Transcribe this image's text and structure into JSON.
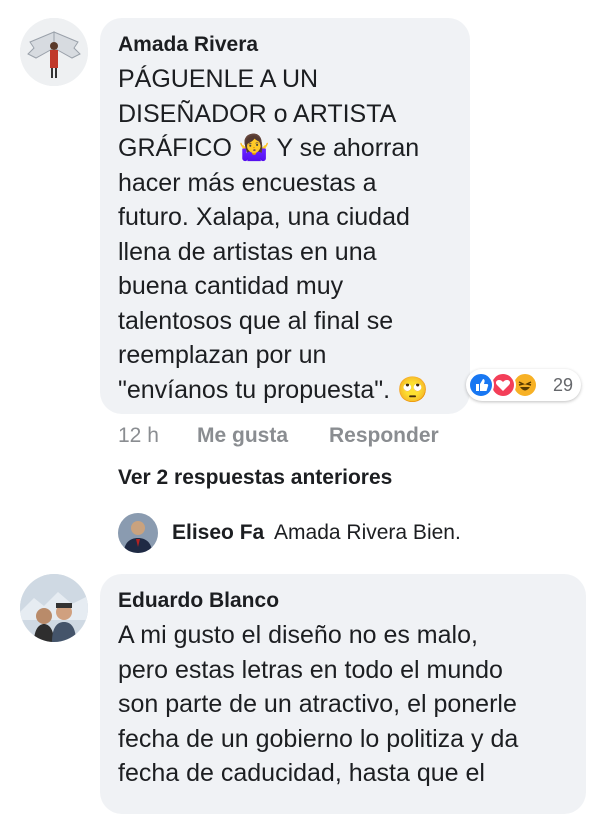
{
  "comments": [
    {
      "author": "Amada Rivera",
      "text": "PÁGUENLE A UN\nDISEÑADOR o ARTISTA\nGRÁFICO 🤷‍♀️ Y se ahorran\nhacer más encuestas a\nfuturo. Xalapa, una ciudad\nllena de artistas en una\nbuena cantidad muy\ntalentosos que al final se\nreemplazan por un\n\"envíanos tu propuesta\". 🙄",
      "time": "12 h",
      "like_label": "Me gusta",
      "reply_label": "Responder",
      "reactions": [
        "like",
        "love",
        "haha"
      ],
      "reaction_count": "29"
    },
    {
      "author": "Eduardo Blanco",
      "text": "A mi gusto el diseño no es malo,\npero estas letras en todo el mundo\nson parte de un atractivo, el ponerle\nfecha de un gobierno lo politiza y da\nfecha de caducidad, hasta que el"
    }
  ],
  "replies": {
    "view_previous": "Ver 2 respuestas anteriores",
    "preview_author": "Eliseo Fa",
    "preview_text": "Amada Rivera Bien."
  },
  "colors": {
    "bubble": "#f0f2f5",
    "meta": "#8a8d91",
    "like": "#1877f2",
    "love": "#f33e58",
    "haha": "#f7b125"
  },
  "icons": {
    "like": "thumbs-up-icon",
    "love": "heart-icon",
    "haha": "laughing-face-icon"
  }
}
